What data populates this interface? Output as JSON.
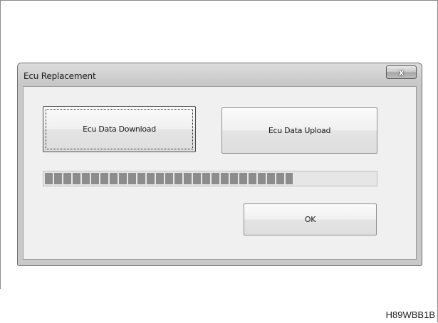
{
  "window": {
    "title": "Ecu Replacement",
    "close_symbol": "x"
  },
  "buttons": {
    "download_label": "Ecu Data Download",
    "upload_label": "Ecu Data Upload",
    "ok_label": "OK"
  },
  "progress": {
    "fraction": 0.75
  },
  "figure_code": "H89WBB1B",
  "icons": {
    "close": "close-icon"
  },
  "colors": {
    "progress_fill": "#8c8c8c",
    "dialog_frame": "#c9c9c9",
    "client_bg": "#f0f0f0"
  }
}
